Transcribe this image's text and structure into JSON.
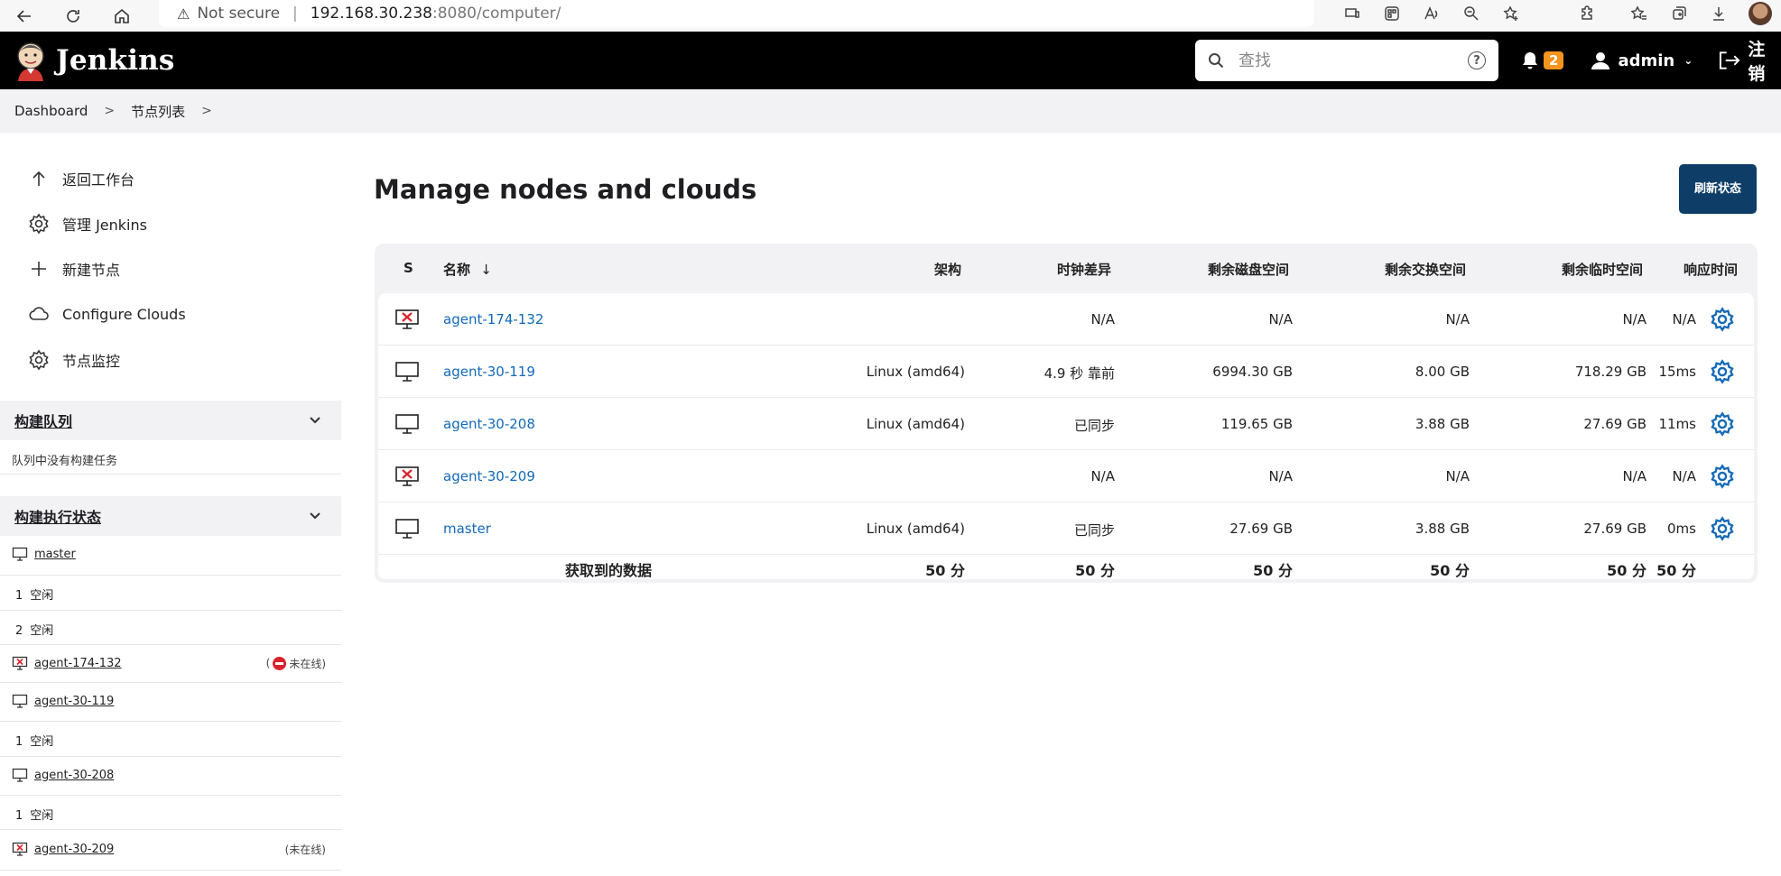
{
  "browser": {
    "security_label": "Not secure",
    "url_host": "192.168.30.238",
    "url_path": ":8080/computer/"
  },
  "header": {
    "brand": "Jenkins",
    "search_placeholder": "查找",
    "help_label": "?",
    "notifications_count": "2",
    "user": "admin",
    "logout": "注销"
  },
  "breadcrumb": {
    "items": [
      "Dashboard",
      "节点列表"
    ]
  },
  "sidebar": {
    "tasks": [
      {
        "label": "返回工作台",
        "icon": "arrow-up-icon"
      },
      {
        "label": "管理 Jenkins",
        "icon": "gear-icon"
      },
      {
        "label": "新建节点",
        "icon": "plus-icon"
      },
      {
        "label": "Configure Clouds",
        "icon": "cloud-icon"
      },
      {
        "label": "节点监控",
        "icon": "gear-icon"
      }
    ],
    "queue": {
      "title": "构建队列",
      "empty": "队列中没有构建任务"
    },
    "executors": {
      "title": "构建执行状态",
      "nodes": [
        {
          "name": "master",
          "status": "",
          "executors": [
            {
              "num": "1",
              "state": "空闲"
            },
            {
              "num": "2",
              "state": "空闲"
            }
          ]
        },
        {
          "name": "agent-174-132",
          "status_prefix": "(",
          "status": "未在线)",
          "executors": []
        },
        {
          "name": "agent-30-119",
          "status": "",
          "executors": [
            {
              "num": "1",
              "state": "空闲"
            }
          ]
        },
        {
          "name": "agent-30-208",
          "status": "",
          "executors": [
            {
              "num": "1",
              "state": "空闲"
            }
          ]
        },
        {
          "name": "agent-30-209",
          "status": "(未在线)",
          "executors": []
        }
      ]
    }
  },
  "main": {
    "title": "Manage nodes and clouds",
    "refresh_button": "刷新状态",
    "table": {
      "headers": {
        "s": "S",
        "name": "名称",
        "sort_indicator": "↓",
        "arch": "架构",
        "clock": "时钟差异",
        "disk": "剩余磁盘空间",
        "swap": "剩余交换空间",
        "temp": "剩余临时空间",
        "response": "响应时间"
      },
      "rows": [
        {
          "name": "agent-174-132",
          "offline": true,
          "arch": "",
          "clock": "N/A",
          "disk": "N/A",
          "swap": "N/A",
          "temp": "N/A",
          "response": "N/A"
        },
        {
          "name": "agent-30-119",
          "offline": false,
          "arch": "Linux (amd64)",
          "clock": "4.9 秒 靠前",
          "disk": "6994.30 GB",
          "swap": "8.00 GB",
          "temp": "718.29 GB",
          "response": "15ms"
        },
        {
          "name": "agent-30-208",
          "offline": false,
          "arch": "Linux (amd64)",
          "clock": "已同步",
          "disk": "119.65 GB",
          "swap": "3.88 GB",
          "temp": "27.69 GB",
          "response": "11ms"
        },
        {
          "name": "agent-30-209",
          "offline": true,
          "arch": "",
          "clock": "N/A",
          "disk": "N/A",
          "swap": "N/A",
          "temp": "N/A",
          "response": "N/A"
        },
        {
          "name": "master",
          "offline": false,
          "arch": "Linux (amd64)",
          "clock": "已同步",
          "disk": "27.69 GB",
          "swap": "3.88 GB",
          "temp": "27.69 GB",
          "response": "0ms"
        }
      ],
      "footer": {
        "label": "获取到的数据",
        "arch": "50 分",
        "clock": "50 分",
        "disk": "50 分",
        "swap": "50 分",
        "temp": "50 分",
        "response": "50 分"
      }
    }
  },
  "colors": {
    "header_bg": "#000000",
    "link": "#1469b8",
    "badge": "#f5951f",
    "button": "#0e3e68",
    "offline_red": "#d9232e"
  }
}
